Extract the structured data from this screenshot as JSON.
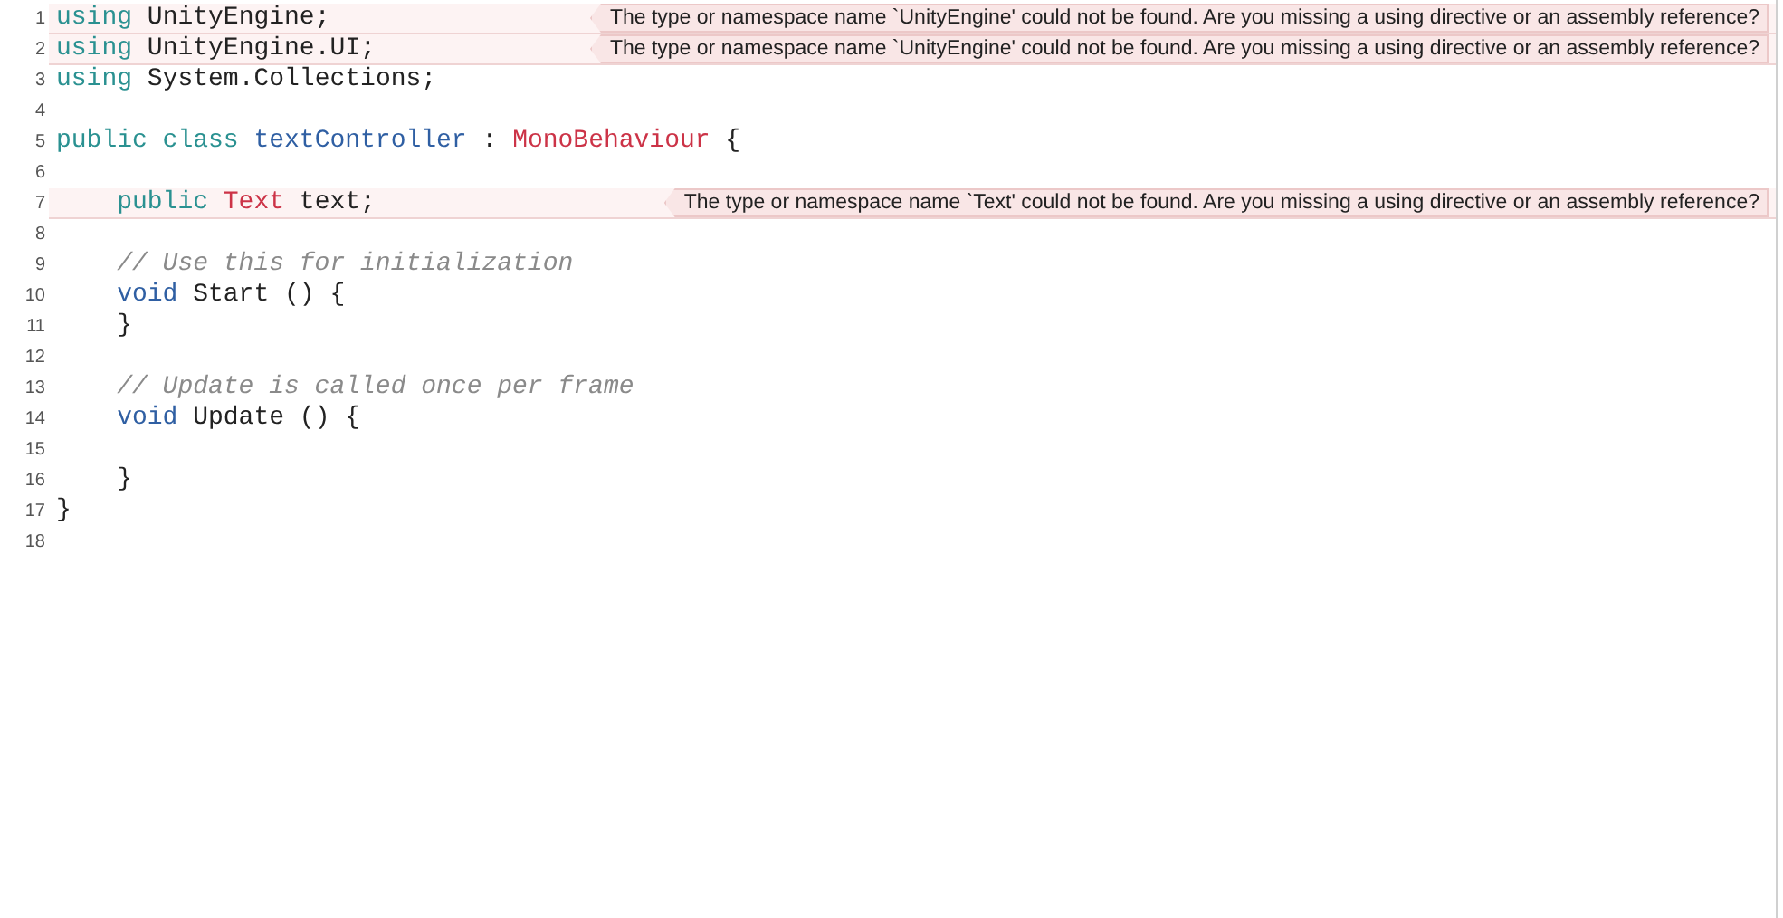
{
  "lines": [
    {
      "number": "1",
      "tokens": [
        {
          "kind": "keyword",
          "text": "using"
        },
        {
          "kind": "plain",
          "text": " UnityEngine;"
        }
      ],
      "error": "The type or namespace name `UnityEngine' could not be found. Are you missing a using directive or an assembly reference?"
    },
    {
      "number": "2",
      "tokens": [
        {
          "kind": "keyword",
          "text": "using"
        },
        {
          "kind": "plain",
          "text": " UnityEngine.UI;"
        }
      ],
      "error": "The type or namespace name `UnityEngine' could not be found. Are you missing a using directive or an assembly reference?"
    },
    {
      "number": "3",
      "tokens": [
        {
          "kind": "keyword",
          "text": "using"
        },
        {
          "kind": "plain",
          "text": " System.Collections;"
        }
      ]
    },
    {
      "number": "4"
    },
    {
      "number": "5",
      "tokens": [
        {
          "kind": "keyword",
          "text": "public class "
        },
        {
          "kind": "name",
          "text": "textController"
        },
        {
          "kind": "plain",
          "text": " : "
        },
        {
          "kind": "type",
          "text": "MonoBehaviour"
        },
        {
          "kind": "plain",
          "text": " {"
        }
      ]
    },
    {
      "number": "6"
    },
    {
      "number": "7",
      "indent": true,
      "tokens": [
        {
          "kind": "keyword",
          "text": "public "
        },
        {
          "kind": "type",
          "text": "Text"
        },
        {
          "kind": "plain",
          "text": " text;"
        }
      ],
      "error": "The type or namespace name `Text' could not be found. Are you missing a using directive or an assembly reference?"
    },
    {
      "number": "8"
    },
    {
      "number": "9",
      "indent": true,
      "tokens": [
        {
          "kind": "comment",
          "text": "// Use this for initialization"
        }
      ]
    },
    {
      "number": "10",
      "indent": true,
      "tokens": [
        {
          "kind": "name",
          "text": "void"
        },
        {
          "kind": "plain",
          "text": " Start () {"
        }
      ]
    },
    {
      "number": "11",
      "indent": true,
      "tokens": [
        {
          "kind": "plain",
          "text": "}"
        }
      ]
    },
    {
      "number": "12"
    },
    {
      "number": "13",
      "indent": true,
      "tokens": [
        {
          "kind": "comment",
          "text": "// Update is called once per frame"
        }
      ]
    },
    {
      "number": "14",
      "indent": true,
      "tokens": [
        {
          "kind": "name",
          "text": "void"
        },
        {
          "kind": "plain",
          "text": " Update () {"
        }
      ]
    },
    {
      "number": "15"
    },
    {
      "number": "16",
      "indent": true,
      "tokens": [
        {
          "kind": "plain",
          "text": "}"
        }
      ]
    },
    {
      "number": "17",
      "tokens": [
        {
          "kind": "plain",
          "text": "}"
        }
      ]
    },
    {
      "number": "18"
    }
  ]
}
